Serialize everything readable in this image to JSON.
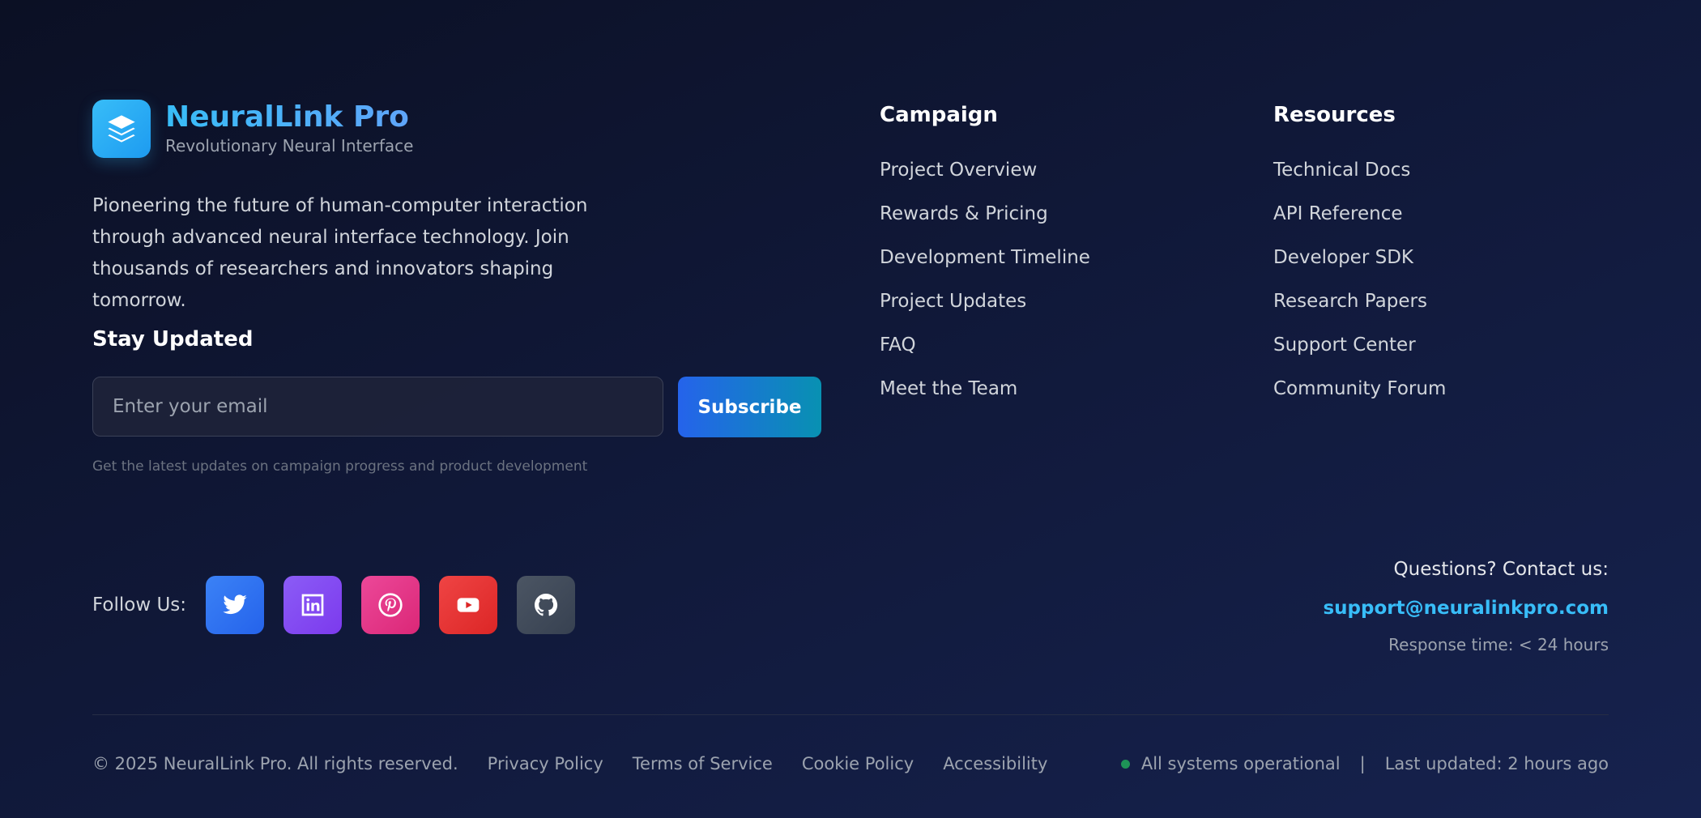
{
  "brand": {
    "name": "NeuralLink Pro",
    "tagline": "Revolutionary Neural Interface",
    "description": "Pioneering the future of human-computer interaction through advanced neural interface technology. Join thousands of researchers and innovators shaping tomorrow.",
    "logo_icon": "layers-icon"
  },
  "newsletter": {
    "title": "Stay Updated",
    "placeholder": "Enter your email",
    "value": "",
    "button_label": "Subscribe",
    "note": "Get the latest updates on campaign progress and product development"
  },
  "campaign": {
    "title": "Campaign",
    "links": [
      "Project Overview",
      "Rewards & Pricing",
      "Development Timeline",
      "Project Updates",
      "FAQ",
      "Meet the Team"
    ]
  },
  "resources": {
    "title": "Resources",
    "links": [
      "Technical Docs",
      "API Reference",
      "Developer SDK",
      "Research Papers",
      "Support Center",
      "Community Forum"
    ]
  },
  "social": {
    "label": "Follow Us:",
    "icons": [
      {
        "name": "twitter-icon",
        "color": "#3b82f6"
      },
      {
        "name": "linkedin-icon",
        "color": "#7c3aed"
      },
      {
        "name": "pinterest-icon",
        "color": "#db2777"
      },
      {
        "name": "youtube-icon",
        "color": "#dc2626"
      },
      {
        "name": "github-icon",
        "color": "#4b5563"
      }
    ]
  },
  "contact": {
    "label": "Questions? Contact us:",
    "email": "support@neuralinkpro.com",
    "response_time": "Response time: < 24 hours"
  },
  "bottom": {
    "copyright": "© 2025 NeuralLink Pro. All rights reserved.",
    "legal_links": [
      "Privacy Policy",
      "Terms of Service",
      "Cookie Policy",
      "Accessibility"
    ],
    "status": "All systems operational",
    "separator": "|",
    "last_updated": "Last updated: 2 hours ago"
  },
  "colors": {
    "accent": "#38bdf8",
    "status_ok": "#22c55e",
    "button_start": "#2563eb",
    "button_end": "#0891b2"
  }
}
